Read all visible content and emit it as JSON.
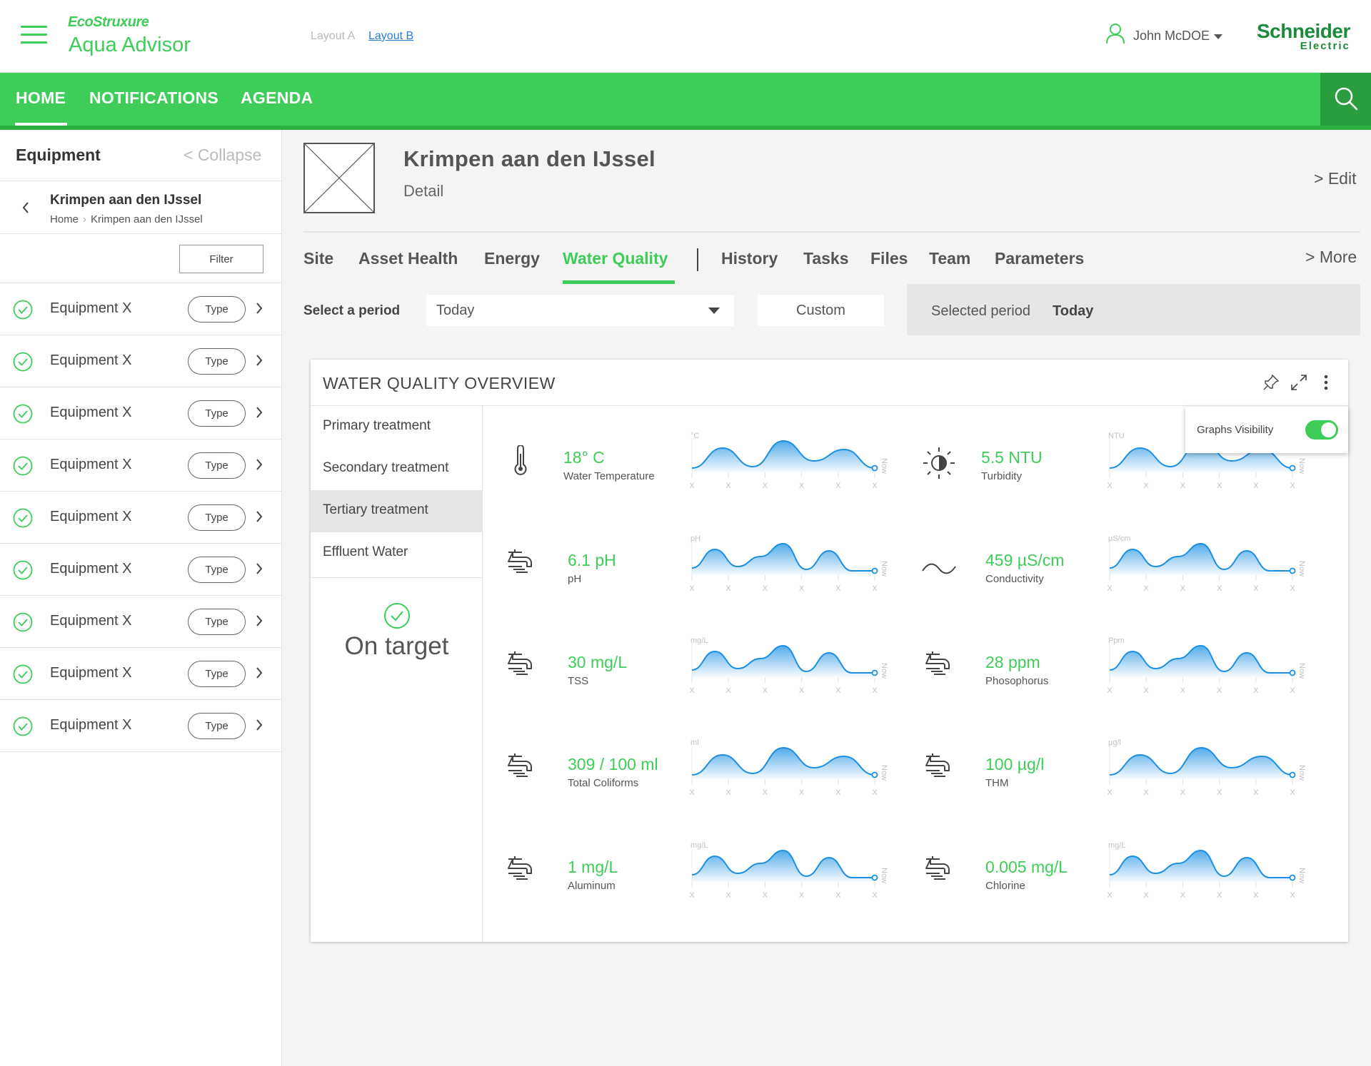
{
  "header": {
    "brand_top": "EcoStruxure",
    "brand_app": "Aqua Advisor",
    "layout_a": "Layout A",
    "layout_b": "Layout B",
    "user_name": "John McDOE",
    "logo_line1": "Schneider",
    "logo_line2": "Electric"
  },
  "nav": {
    "items": [
      "HOME",
      "NOTIFICATIONS",
      "AGENDA"
    ],
    "active": "HOME"
  },
  "sidebar": {
    "title": "Equipment",
    "collapse": "< Collapse",
    "site": "Krimpen aan den IJssel",
    "crumb_home": "Home",
    "crumb_site": "Krimpen aan den IJssel",
    "filter": "Filter",
    "equipment": [
      {
        "label": "Equipment X",
        "type": "Type"
      },
      {
        "label": "Equipment X",
        "type": "Type"
      },
      {
        "label": "Equipment X",
        "type": "Type"
      },
      {
        "label": "Equipment X",
        "type": "Type"
      },
      {
        "label": "Equipment X",
        "type": "Type"
      },
      {
        "label": "Equipment X",
        "type": "Type"
      },
      {
        "label": "Equipment X",
        "type": "Type"
      },
      {
        "label": "Equipment X",
        "type": "Type"
      },
      {
        "label": "Equipment X",
        "type": "Type"
      }
    ]
  },
  "page": {
    "title": "Krimpen aan den IJssel",
    "subtitle": "Detail",
    "edit": "> Edit",
    "more": "> More",
    "tabs": [
      "Site",
      "Asset Health",
      "Energy",
      "Water Quality",
      "History",
      "Tasks",
      "Files",
      "Team",
      "Parameters"
    ],
    "active_tab": "Water Quality"
  },
  "period": {
    "label": "Select a period",
    "selected_option": "Today",
    "custom": "Custom",
    "selected_label": "Selected period",
    "selected_value": "Today"
  },
  "widget": {
    "title": "WATER QUALITY OVERVIEW",
    "graphs_visibility_label": "Graphs Visibility",
    "graphs_visibility_on": true,
    "treatments": [
      "Primary treatment",
      "Secondary treatment",
      "Tertiary treatment",
      "Effluent Water"
    ],
    "active_treatment": "Tertiary treatment",
    "status": "On target",
    "axis_tick": "X",
    "axis_now": "Now",
    "metrics": [
      {
        "value": "18° C",
        "name": "Water Temperature",
        "unit": "°C",
        "icon": "thermometer-icon"
      },
      {
        "value": "5.5 NTU",
        "name": "Turbidity",
        "unit": "NTU",
        "icon": "turbidity-icon"
      },
      {
        "value": "6.1 pH",
        "name": "pH",
        "unit": "pH",
        "icon": "faucet-icon"
      },
      {
        "value": "459 µS/cm",
        "name": "Conductivity",
        "unit": "µS/cm",
        "icon": "wave-icon"
      },
      {
        "value": "30 mg/L",
        "name": "TSS",
        "unit": "mg/L",
        "icon": "faucet-icon"
      },
      {
        "value": "28 ppm",
        "name": "Phosophorus",
        "unit": "Ppm",
        "icon": "faucet-icon"
      },
      {
        "value": "309 / 100 ml",
        "name": "Total Coliforms",
        "unit": "ml",
        "icon": "faucet-icon"
      },
      {
        "value": "100 µg/l",
        "name": "THM",
        "unit": "µg/l",
        "icon": "faucet-icon"
      },
      {
        "value": "1 mg/L",
        "name": "Aluminum",
        "unit": "mg/L",
        "icon": "faucet-icon"
      },
      {
        "value": "0.005 mg/L",
        "name": "Chlorine",
        "unit": "mg/L",
        "icon": "faucet-icon"
      }
    ]
  },
  "colors": {
    "brand_green": "#3dcd58",
    "dark_green": "#2a9e3e",
    "graph_blue": "#1a8fe3"
  }
}
